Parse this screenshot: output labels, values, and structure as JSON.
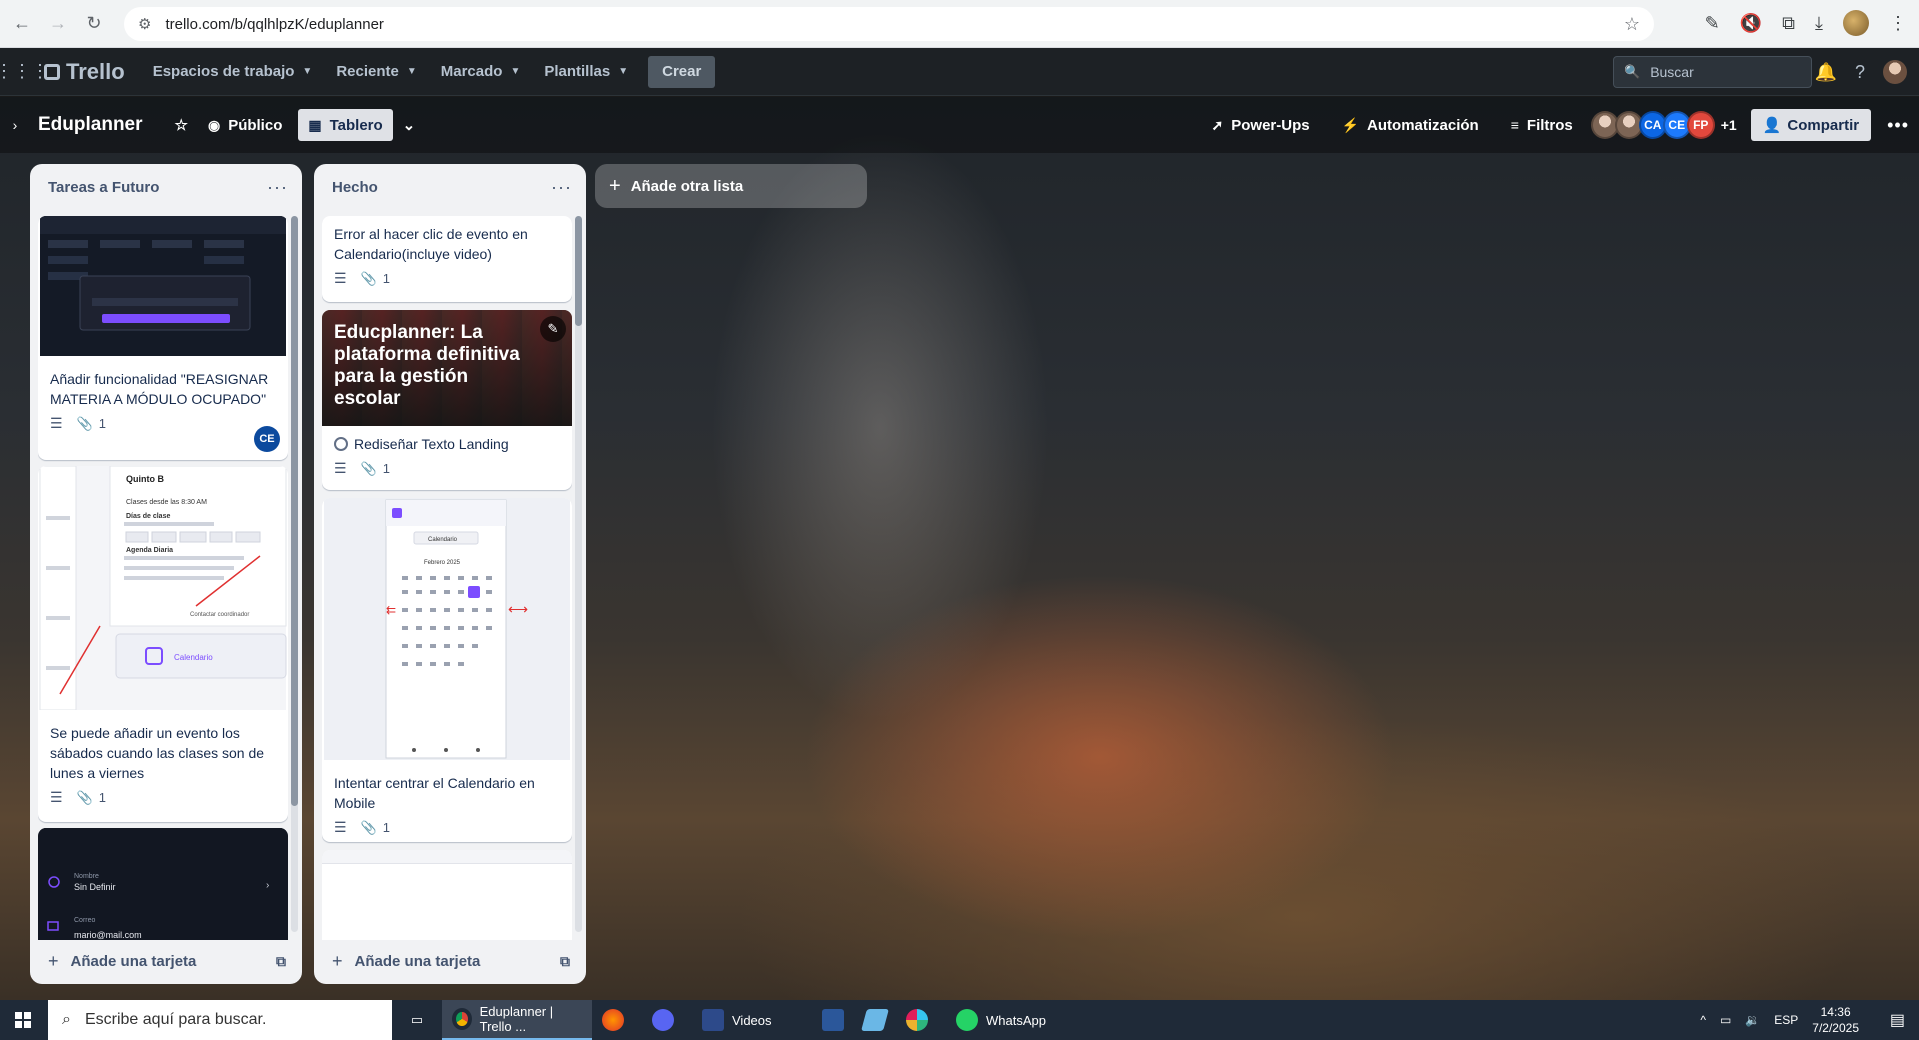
{
  "browser": {
    "url": "trello.com/b/qqlhlpzK/eduplanner"
  },
  "header": {
    "logo": "Trello",
    "menus": [
      "Espacios de trabajo",
      "Reciente",
      "Marcado",
      "Plantillas"
    ],
    "create": "Crear",
    "search_placeholder": "Buscar"
  },
  "board": {
    "title": "Eduplanner",
    "visibility": "Público",
    "view": "Tablero",
    "powerups": "Power-Ups",
    "automation": "Automatización",
    "filters": "Filtros",
    "members": [
      "CA",
      "CE",
      "FP"
    ],
    "more_members": "+1",
    "share": "Compartir",
    "add_list": "Añade otra lista"
  },
  "lists": [
    {
      "title": "Tareas a Futuro",
      "add_card": "Añade una tarjeta",
      "cards": [
        {
          "title": "Añadir funcionalidad \"REASIGNAR MATERIA A MÓDULO OCUPADO\"",
          "attachments": "1",
          "member": "CE"
        },
        {
          "title": "Se puede añadir un evento los sábados cuando las clases son de lunes a viernes",
          "attachments": "1",
          "cover_text": {
            "heading": "Quinto B",
            "schedule": "Clases desde las 8:30 AM",
            "days": "Días de clase",
            "agenda": "Agenda Diaria",
            "calendar": "Calendario",
            "contact": "Contactar coordinador"
          }
        },
        {
          "cover_text": {
            "name_label": "Nombre",
            "name_value": "Sin Definir",
            "email_label": "Correo",
            "email_value": "mario@mail.com"
          }
        }
      ]
    },
    {
      "title": "Hecho",
      "add_card": "Añade una tarjeta",
      "cards": [
        {
          "title": "Error al hacer clic de evento en Calendario(incluye video)",
          "attachments": "1"
        },
        {
          "title": "Rediseñar Texto Landing",
          "attachments": "1",
          "cover_heading": "Educplanner: La plataforma definitiva para la gestión escolar"
        },
        {
          "title": "Intentar centrar el Calendario en Mobile",
          "attachments": "1",
          "cover_text": {
            "month": "Febrero 2025",
            "calendar": "Calendario"
          }
        }
      ]
    }
  ],
  "taskbar": {
    "search_placeholder": "Escribe aquí para buscar.",
    "active_window": "Eduplanner | Trello ...",
    "folder": "Videos",
    "whatsapp": "WhatsApp",
    "lang": "ESP",
    "time": "14:36",
    "date": "7/2/2025"
  },
  "colors": {
    "header_bg": "#1d2125",
    "list_bg": "#f1f2f4",
    "member_ca": "#0c66e4",
    "member_fp": "#e2483d"
  }
}
